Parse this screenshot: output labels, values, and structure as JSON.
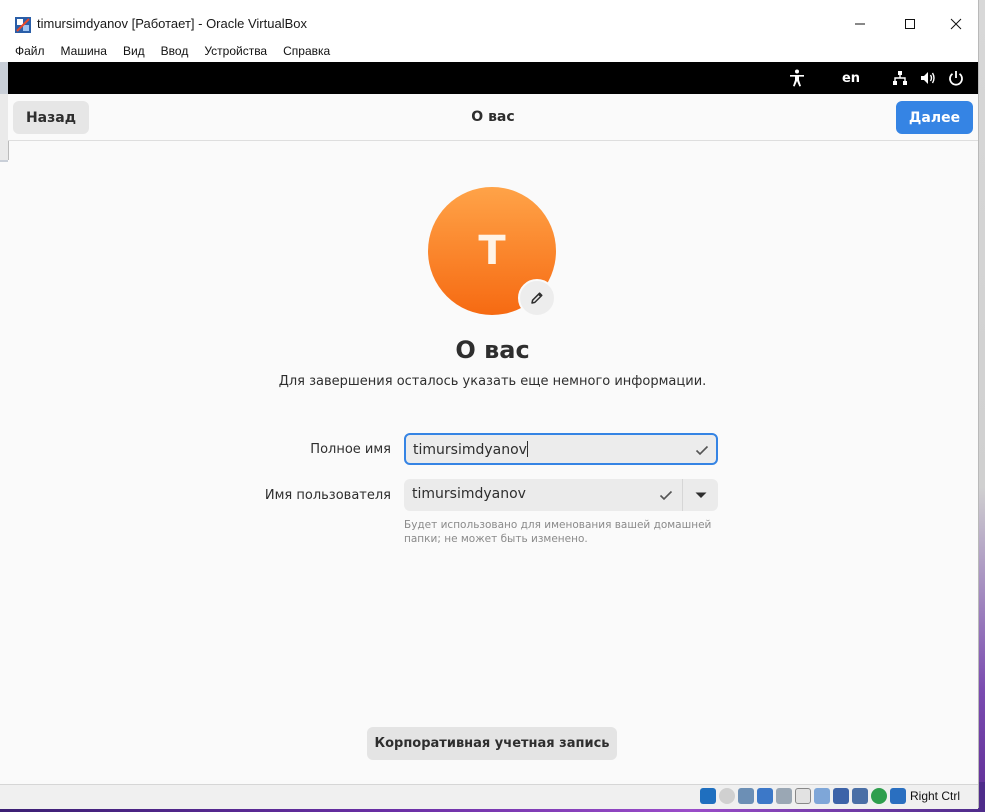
{
  "window": {
    "title": "timursimdyanov [Работает] - Oracle VirtualBox",
    "controls": [
      "minimize",
      "maximize",
      "close"
    ]
  },
  "menubar": {
    "items": [
      "Файл",
      "Машина",
      "Вид",
      "Ввод",
      "Устройства",
      "Справка"
    ]
  },
  "gnome_topbar": {
    "accessibility_icon": "accessibility-icon",
    "language": "en",
    "status_icons": [
      "network-icon",
      "volume-icon",
      "power-icon"
    ]
  },
  "headerbar": {
    "back_label": "Назад",
    "title": "О вас",
    "next_label": "Далее"
  },
  "avatar": {
    "initial": "T",
    "edit_icon": "pencil-icon",
    "colors": {
      "top": "#ffa348",
      "bottom": "#f66a12"
    }
  },
  "main": {
    "title": "О вас",
    "subtitle": "Для завершения осталось указать еще немного информации."
  },
  "form": {
    "fullname": {
      "label": "Полное имя",
      "value": "timursimdyanov"
    },
    "username": {
      "label": "Имя пользователя",
      "value": "timursimdyanov"
    },
    "hint": "Будет использовано для именования вашей домашней папки; не может быть изменено."
  },
  "footer": {
    "enterprise_button": "Корпоративная учетная запись"
  },
  "statusbar": {
    "host_key": "Right Ctrl"
  },
  "colors": {
    "accent": "#3584e4",
    "background": "#fafafa",
    "topbar": "#000000"
  }
}
